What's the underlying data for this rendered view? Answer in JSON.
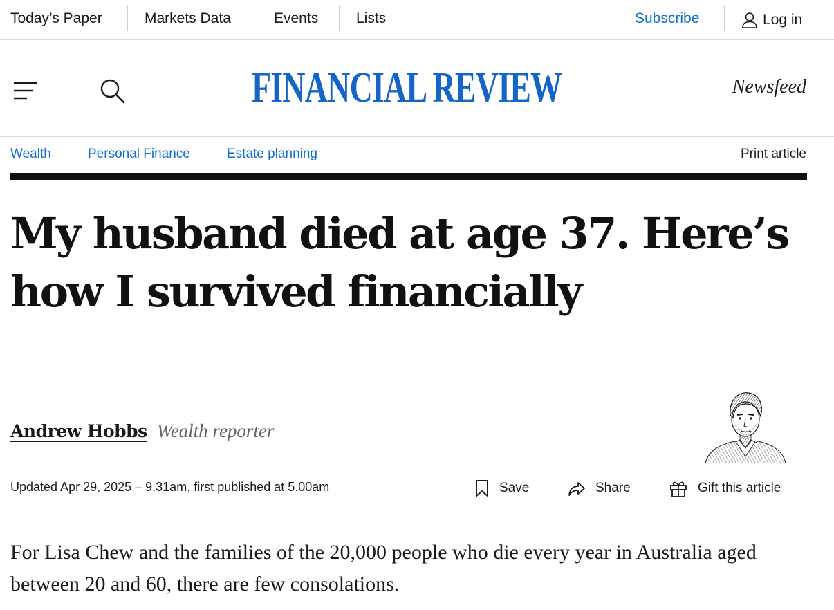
{
  "topbar": {
    "todays_paper": "Today’s Paper",
    "markets_data": "Markets Data",
    "events": "Events",
    "lists": "Lists",
    "subscribe": "Subscribe",
    "login": "Log in"
  },
  "masthead": {
    "logo_text": "FINANCIAL REVIEW",
    "newsfeed": "Newsfeed",
    "brand_color": "#1565c8"
  },
  "section_nav": {
    "breadcrumbs": [
      "Wealth",
      "Personal Finance",
      "Estate planning"
    ],
    "print_label": "Print article",
    "link_color": "#0f6fd0"
  },
  "article": {
    "headline_line1": "My husband died at age 37. Here’s",
    "headline_line2": "how I survived financially",
    "author": "Andrew Hobbs",
    "author_role": "Wealth reporter",
    "dateline": "Updated Apr 29, 2025 – 9.31am, first published at 5.00am",
    "lede": "For Lisa Chew and the families of the 20,000 people who die every year in Australia aged between 20 and 60, there are few consolations."
  },
  "actions": {
    "save": "Save",
    "share": "Share",
    "gift": "Gift this article"
  },
  "icons": [
    "menu-icon",
    "search-icon",
    "user-icon",
    "bookmark-icon",
    "share-arrow-icon",
    "gift-icon"
  ]
}
